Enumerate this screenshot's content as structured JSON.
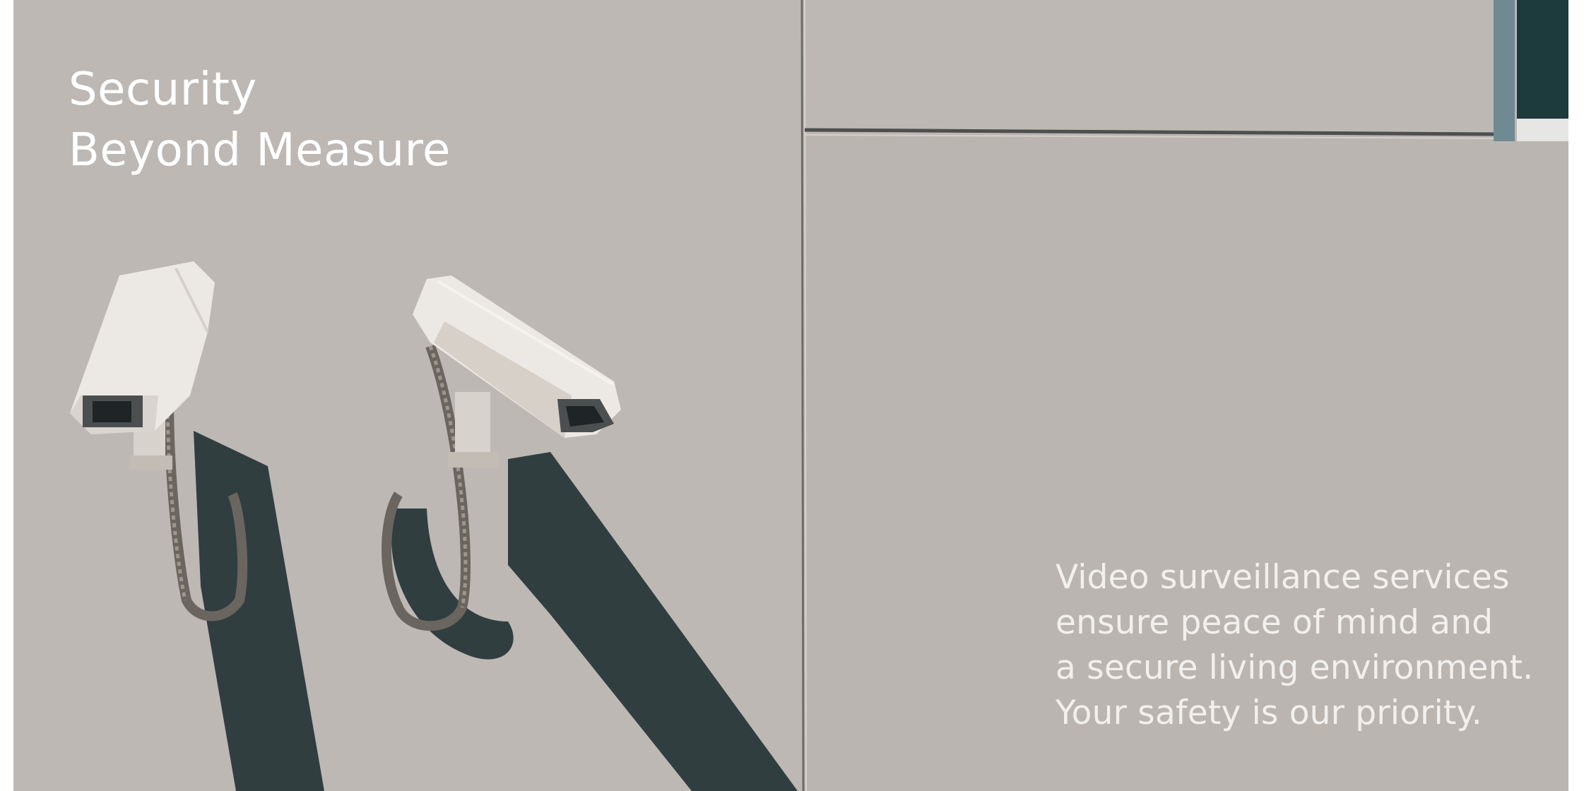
{
  "hero": {
    "headline_lines": [
      "Security",
      "Beyond Measure"
    ],
    "tagline_lines": [
      "Video surveillance services",
      "ensure peace of mind and",
      "a secure living environment.",
      "Your safety is our priority."
    ],
    "image_subject": "two-cctv-cameras-on-wall"
  },
  "colors": {
    "wall": "#bdb8b4",
    "shadow": "#303e40",
    "camera": "#ece8e3",
    "text": "#ffffff"
  }
}
